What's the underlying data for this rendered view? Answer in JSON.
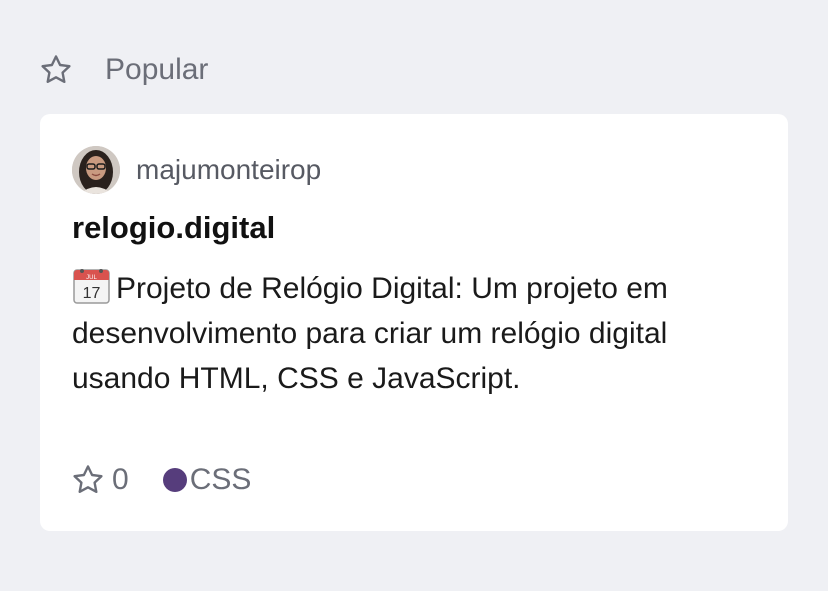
{
  "section": {
    "title": "Popular",
    "icon": "star-outline-icon"
  },
  "repo": {
    "owner": "majumonteirop",
    "name": "relogio.digital",
    "description_icon": "calendar-icon",
    "description": "Projeto de Relógio Digital: Um projeto em desenvolvimento para criar um relógio digital usando HTML, CSS e JavaScript.",
    "calendar_month": "JUL",
    "calendar_day": "17",
    "stars": "0",
    "language": "CSS",
    "language_color": "#563d7c"
  },
  "colors": {
    "background": "#eff0f4",
    "card": "#ffffff",
    "muted_text": "#6b6e78"
  }
}
